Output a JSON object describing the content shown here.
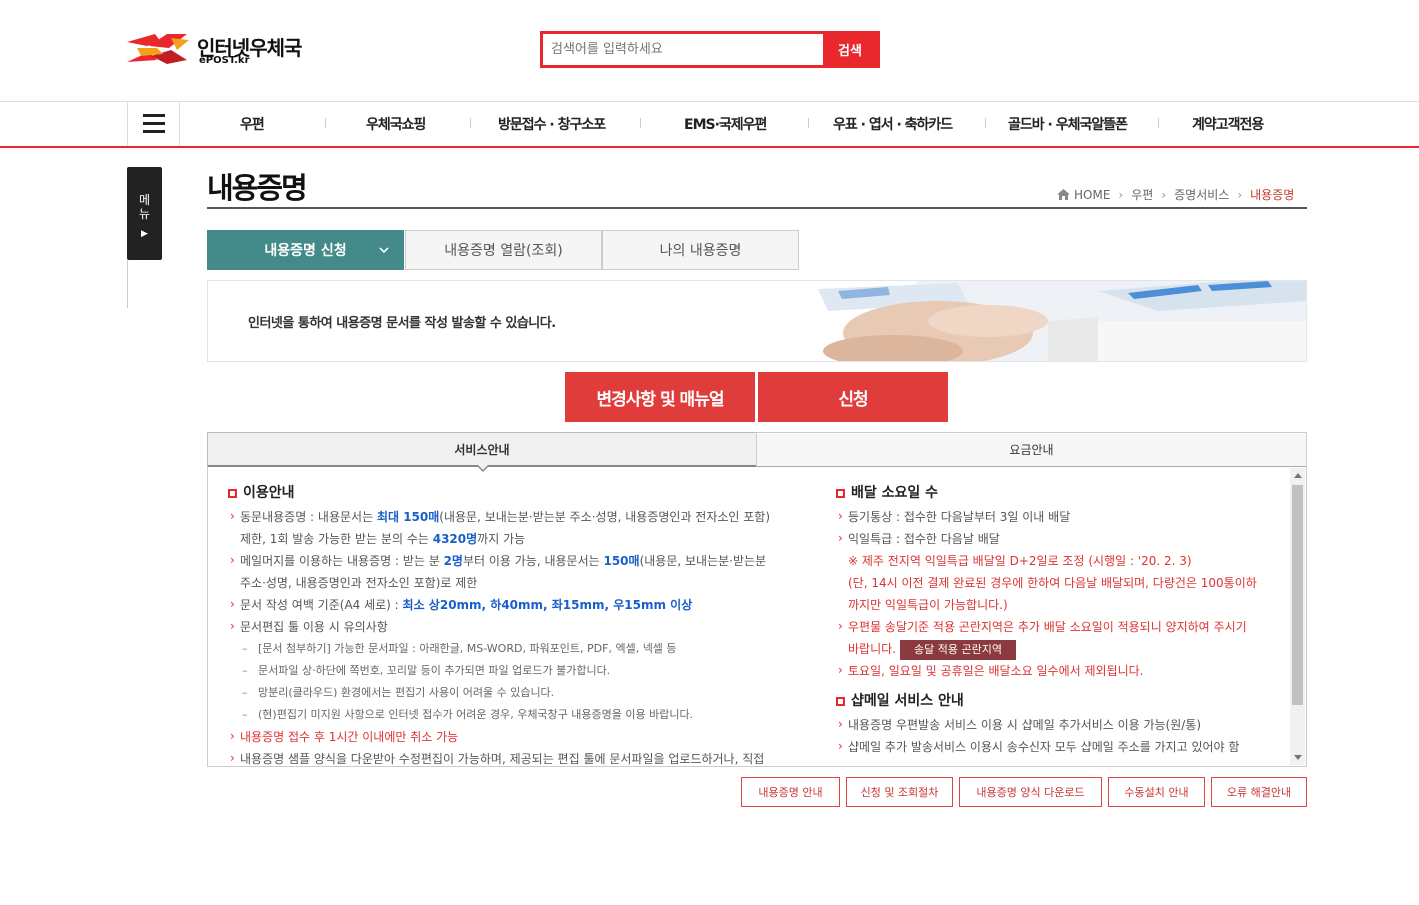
{
  "header": {
    "logo_text": "인터넷우체국",
    "logo_sub": "ePOST.kr",
    "search_placeholder": "검색어를 입력하세요",
    "search_button": "검색"
  },
  "gnb": {
    "items": [
      "우편",
      "우체국쇼핑",
      "방문접수 · 창구소포",
      "EMS·국제우편",
      "우표 · 엽서 · 축하카드",
      "골드바 · 우체국알뜰폰",
      "계약고객전용"
    ]
  },
  "side_menu": {
    "label1": "메",
    "label2": "뉴"
  },
  "page": {
    "title": "내용증명",
    "breadcrumb": [
      "HOME",
      "우편",
      "증명서비스",
      "내용증명"
    ]
  },
  "tabs": [
    "내용증명 신청",
    "내용증명 열람(조회)",
    "나의 내용증명"
  ],
  "banner_text": "인터넷을 통하여 내용증명 문서를 작성 발송할 수 있습니다.",
  "buttons": {
    "manual": "변경사항 및 매뉴얼",
    "apply": "신청"
  },
  "content_tabs": [
    "서비스안내",
    "요금안내"
  ],
  "left": {
    "title": "이용안내",
    "l1a": "동문내용증명 : 내용문서는 ",
    "l1b": "최대 150매",
    "l1c": "(내용문, 보내는분·받는분 주소·성명, 내용증명인과 전자소인 포함)",
    "l2a": "제한, 1회 발송 가능한 받는 분의 수는 ",
    "l2b": "4320명",
    "l2c": "까지 가능",
    "l3a": "메일머지를 이용하는 내용증명 : 받는 분 ",
    "l3b": "2명",
    "l3c": "부터 이용 가능, 내용문서는 ",
    "l3d": "150매",
    "l3e": "(내용문, 보내는분·받는분",
    "l4": "주소·성명, 내용증명인과 전자소인 포함)로 제한",
    "l5a": "문서 작성 여백 기준(A4 세로) : ",
    "l5b": "최소 상20mm, 하40mm, 좌15mm, 우15mm 이상",
    "l6": "문서편집 툴 이용 시 유의사항",
    "s1": "[문서 첨부하기] 가능한 문서파일 : 아래한글, MS-WORD, 파워포인트, PDF, 엑셀, 넥셀 등",
    "s2": "문서파일 상·하단에 쪽번호, 꼬리말 등이 추가되면 파일 업로드가 불가합니다.",
    "s3": "망분리(클라우드) 환경에서는 편집기 사용이 어려울 수 있습니다.",
    "s4": "(현)편집기 미지원 사항으로 인터넷 접수가 어려운 경우, 우체국창구 내용증명을 이용 바랍니다.",
    "l7": "내용증명 접수 후 1시간 이내에만 취소 가능",
    "l8": "내용증명 샘플 양식을 다운받아 수정편집이 가능하며, 제공되는 편집 툴에 문서파일을 업로드하거나, 직접"
  },
  "right": {
    "title1": "배달 소요일 수",
    "r1": "등기통상 : 접수한 다음날부터 3일 이내 배달",
    "r2": "익일특급 : 접수한 다음날 배달",
    "r3": "※ 제주 전지역 익일특급 배달일 D+2일로 조정 (시행일 : '20. 2. 3)",
    "r4": "(단, 14시 이전 결제 완료된 경우에 한하여 다음날 배달되며, 다량건은 100통이하",
    "r5": "까지만 익일특급이 가능합니다.)",
    "r6": "우편물 송달기준 적용 곤란지역은 추가 배달 소요일이 적용되니 양지하여 주시기",
    "r7": "바랍니다.",
    "r7_badge": "송달 적용 곤란지역",
    "r8": "토요일, 일요일 및 공휴일은 배달소요 일수에서 제외됩니다.",
    "title2": "샵메일 서비스 안내",
    "r9": "내용증명 우편발송 서비스 이용 시 샵메일 추가서비스 이용 가능(원/통)",
    "r10": "샵메일 추가 발송서비스 이용시 송수신자 모두 샵메일 주소를 가지고 있어야 함"
  },
  "bottom_buttons": [
    "내용증명 안내",
    "신청 및 조회절차",
    "내용증명 양식 다운로드",
    "수동설치 안내",
    "오류 해결안내"
  ],
  "colors": {
    "brand_red": "#e8282d",
    "tab_teal": "#448a8a",
    "button_red": "#e03c3c",
    "link_blue": "#1a5fc8"
  }
}
